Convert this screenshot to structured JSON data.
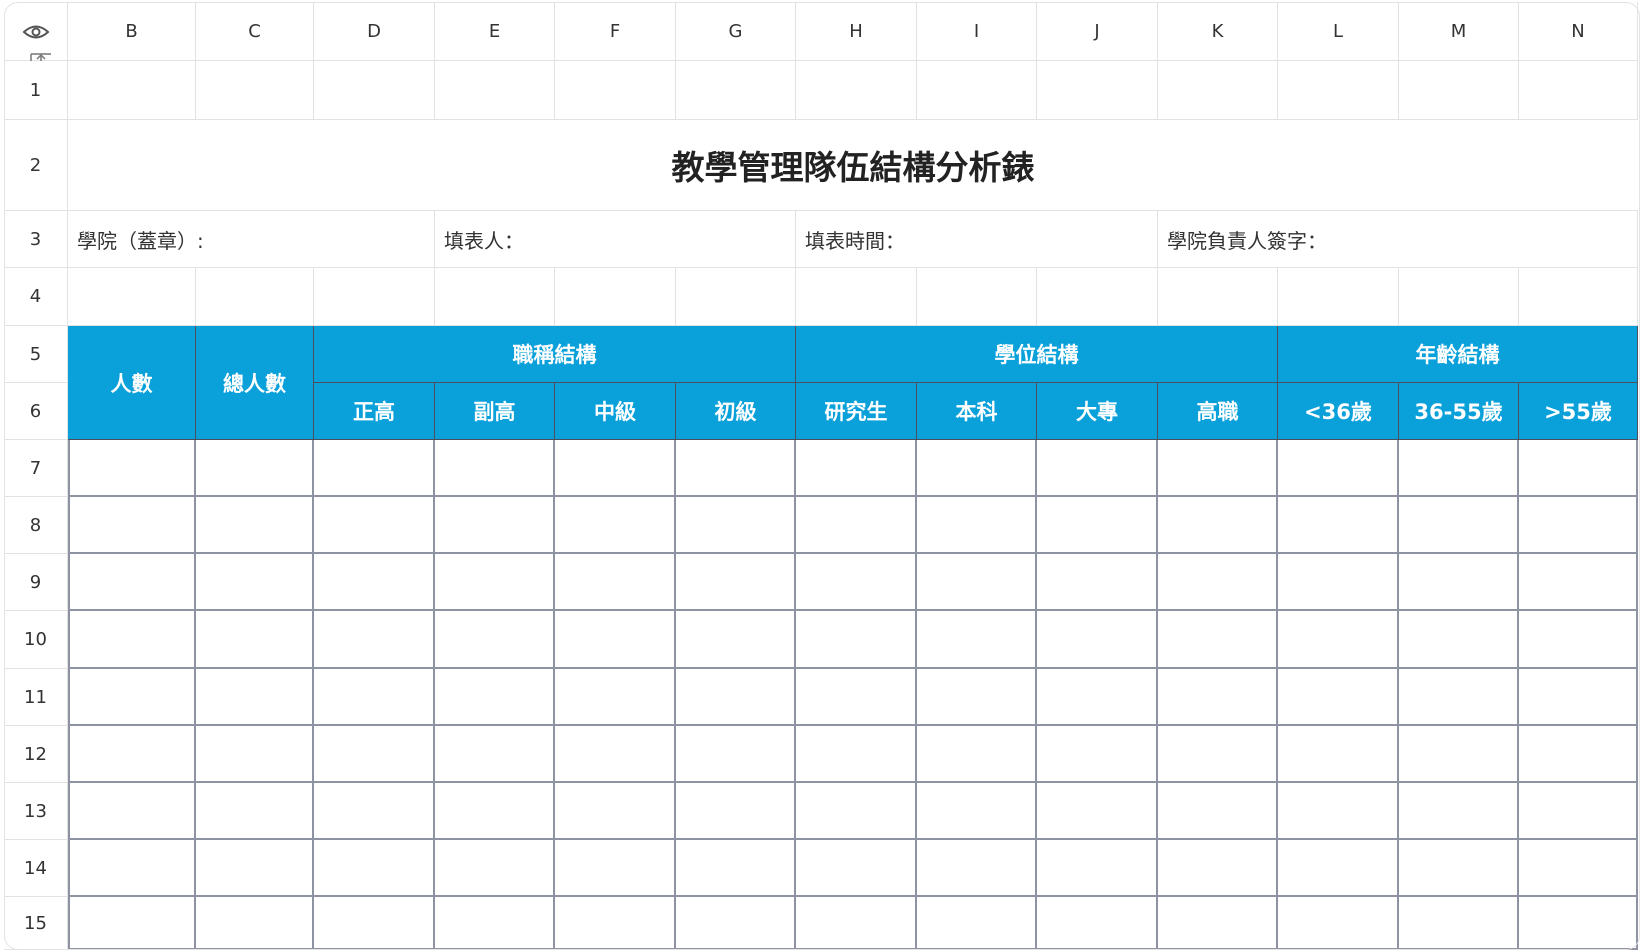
{
  "column_headers": [
    "B",
    "C",
    "D",
    "E",
    "F",
    "G",
    "H",
    "I",
    "J",
    "K",
    "L",
    "M",
    "N"
  ],
  "row_headers": [
    "1",
    "2",
    "3",
    "4",
    "5",
    "6",
    "7",
    "8",
    "9",
    "10",
    "11",
    "12",
    "13",
    "14",
    "15"
  ],
  "corner": {
    "icon": "eye-icon",
    "resize_icon": "row-resize-icon"
  },
  "title": "教學管理隊伍結構分析錶",
  "meta": {
    "college": "學院（蓋章）:",
    "filler": "填表人：",
    "fill_time": "填表時間：",
    "head_signature": "學院負責人簽字："
  },
  "table_header": {
    "count": "人數",
    "total": "總人數",
    "title_structure": "職稱結構",
    "degree_structure": "學位結構",
    "age_structure": "年齡結構",
    "sub": [
      "正高",
      "副高",
      "中級",
      "初級",
      "研究生",
      "本科",
      "大專",
      "高職",
      "<36歲",
      "36-55歲",
      ">55歲"
    ]
  },
  "colors": {
    "header_fill": "#0aa0da",
    "grid_line": "#8e93a4"
  }
}
